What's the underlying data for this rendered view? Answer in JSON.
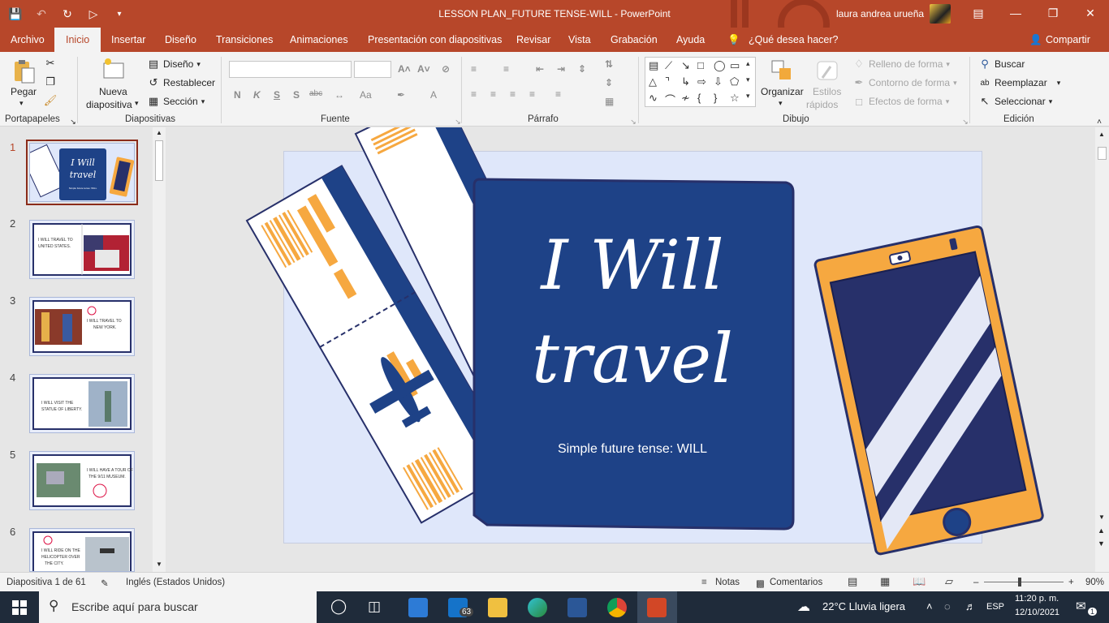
{
  "window": {
    "title": "LESSON PLAN_FUTURE TENSE-WILL  -  PowerPoint",
    "user": "laura andrea urueña",
    "share_label": "Compartir",
    "tell_me": "¿Qué desea hacer?"
  },
  "tabs": [
    "Archivo",
    "Inicio",
    "Insertar",
    "Diseño",
    "Transiciones",
    "Animaciones",
    "Presentación con diapositivas",
    "Revisar",
    "Vista",
    "Grabación",
    "Ayuda"
  ],
  "ribbon": {
    "clipboard": {
      "paste": "Pegar",
      "group": "Portapapeles"
    },
    "slides": {
      "new_slide_1": "Nueva",
      "new_slide_2": "diapositiva",
      "layout": "Diseño",
      "reset": "Restablecer",
      "section": "Sección",
      "group": "Diapositivas"
    },
    "font": {
      "group": "Fuente",
      "bold": "N",
      "italic": "K",
      "underline": "S",
      "shadow": "S",
      "strike": "abc",
      "case": "Aa",
      "color": "A"
    },
    "paragraph": {
      "group": "Párrafo"
    },
    "drawing": {
      "arrange": "Organizar",
      "quick_styles_1": "Estilos",
      "quick_styles_2": "rápidos",
      "fill": "Relleno de forma",
      "outline": "Contorno de forma",
      "effects": "Efectos de forma",
      "group": "Dibujo"
    },
    "editing": {
      "find": "Buscar",
      "replace": "Reemplazar",
      "select": "Seleccionar",
      "group": "Edición"
    }
  },
  "thumbnails": [
    {
      "num": "1",
      "text": "I Will travel"
    },
    {
      "num": "2",
      "text": "I Will travel to United States."
    },
    {
      "num": "3",
      "text": "I Will travel to New York."
    },
    {
      "num": "4",
      "text": "I Will visit the statue of liberty."
    },
    {
      "num": "5",
      "text": "I Will have a tour of the 9/11 museum."
    },
    {
      "num": "6",
      "text": "I Will ride on the helicopter over the city."
    }
  ],
  "slide": {
    "title_line1": "I Will",
    "title_line2": "travel",
    "subtitle": "Simple future tense: WILL"
  },
  "status": {
    "slide_count": "Diapositiva 1 de 61",
    "language": "Inglés (Estados Unidos)",
    "notes": "Notas",
    "comments": "Comentarios",
    "zoom_minus": "–",
    "zoom_plus": "+",
    "zoom": "90%"
  },
  "taskbar": {
    "search": "Escribe aquí para buscar",
    "mail_badge": "63",
    "weather": "22°C  Lluvia ligera",
    "lang": "ESP",
    "time": "11:20 p. m.",
    "date": "12/10/2021",
    "notif_badge": "1"
  },
  "colors": {
    "accent": "#b7472a",
    "navy": "#1e4287",
    "orange": "#f6a840",
    "slide_bg": "#dfe7fa"
  }
}
